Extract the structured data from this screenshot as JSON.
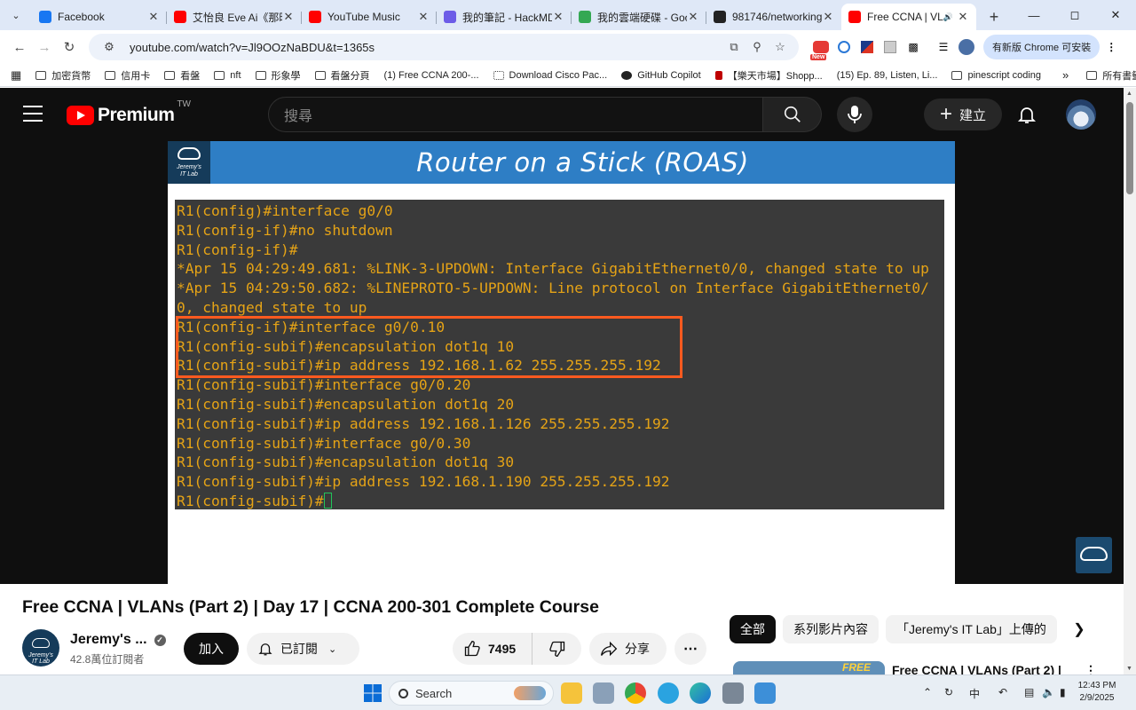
{
  "browser": {
    "tabs": [
      {
        "title": "Facebook",
        "color": "#1877f2",
        "active": false
      },
      {
        "title": "艾怡良 Eve Ai《那時",
        "color": "#ff0000",
        "active": false
      },
      {
        "title": "YouTube Music",
        "color": "#ff0000",
        "active": false
      },
      {
        "title": "我的筆記 - HackMD",
        "color": "#6c5ce7",
        "active": false
      },
      {
        "title": "我的雲端硬碟 - Goog",
        "color": "#34a853",
        "active": false
      },
      {
        "title": "981746/networking-f",
        "color": "#222222",
        "active": false
      },
      {
        "title": "Free CCNA | VLA",
        "color": "#ff0000",
        "active": true
      }
    ],
    "url": "youtube.com/watch?v=Jl9OOzNaBDU&t=1365s",
    "update_label": "有新版 Chrome 可安裝",
    "new_badge": "New",
    "bookmarks": [
      {
        "label": "加密貨幣",
        "kind": "folder"
      },
      {
        "label": "信用卡",
        "kind": "folder"
      },
      {
        "label": "看盤",
        "kind": "folder"
      },
      {
        "label": "nft",
        "kind": "folder"
      },
      {
        "label": "形象學",
        "kind": "folder"
      },
      {
        "label": "看盤分頁",
        "kind": "folder"
      },
      {
        "label": "(1) Free CCNA 200-...",
        "kind": "youtube"
      },
      {
        "label": "Download Cisco Pac...",
        "kind": "site"
      },
      {
        "label": "GitHub Copilot",
        "kind": "github"
      },
      {
        "label": "【樂天市場】Shopp...",
        "kind": "rakuten"
      },
      {
        "label": "(15) Ep. 89, Listen, Li...",
        "kind": "youtube"
      },
      {
        "label": "pinescript coding",
        "kind": "folder"
      }
    ],
    "bookmarks_overflow": "»",
    "all_bookmarks": "所有書籤"
  },
  "youtube": {
    "logo_text": "Premium",
    "country": "TW",
    "search_placeholder": "搜尋",
    "create_label": "建立",
    "slide": {
      "logo_line1": "Jeremy's",
      "logo_line2": "IT Lab",
      "title": "Router on a Stick (ROAS)",
      "terminal_lines": [
        "R1(config)#interface g0/0",
        "R1(config-if)#no shutdown",
        "R1(config-if)#",
        "*Apr 15 04:29:49.681: %LINK-3-UPDOWN: Interface GigabitEthernet0/0, changed state to up",
        "*Apr 15 04:29:50.682: %LINEPROTO-5-UPDOWN: Line protocol on Interface GigabitEthernet0/",
        "0, changed state to up",
        "R1(config-if)#interface g0/0.10",
        "R1(config-subif)#encapsulation dot1q 10",
        "R1(config-subif)#ip address 192.168.1.62 255.255.255.192",
        "R1(config-subif)#interface g0/0.20",
        "R1(config-subif)#encapsulation dot1q 20",
        "R1(config-subif)#ip address 192.168.1.126 255.255.255.192",
        "R1(config-subif)#interface g0/0.30",
        "R1(config-subif)#encapsulation dot1q 30",
        "R1(config-subif)#ip address 192.168.1.190 255.255.255.192",
        "R1(config-subif)#"
      ]
    },
    "video_title": "Free CCNA | VLANs (Part 2) | Day 17 | CCNA 200-301 Complete Course",
    "channel": {
      "name": "Jeremy's ...",
      "subscribers": "42.8萬位訂閱者",
      "avatar_line1": "Jeremy's",
      "avatar_line2": "IT Lab"
    },
    "join_label": "加入",
    "subscribed_label": "已訂閱",
    "like_count": "7495",
    "share_label": "分享",
    "chips": [
      {
        "label": "全部",
        "selected": true
      },
      {
        "label": "系列影片內容",
        "selected": false
      },
      {
        "label": "「Jeremy's IT Lab」上傳的",
        "selected": false
      }
    ],
    "recommendation": {
      "title": "Free CCNA | VLANs (Part 2) |",
      "thumb_text": "FREE"
    }
  },
  "taskbar": {
    "search_label": "Search",
    "ime": "中",
    "time": "12:43 PM",
    "date": "2/9/2025"
  }
}
